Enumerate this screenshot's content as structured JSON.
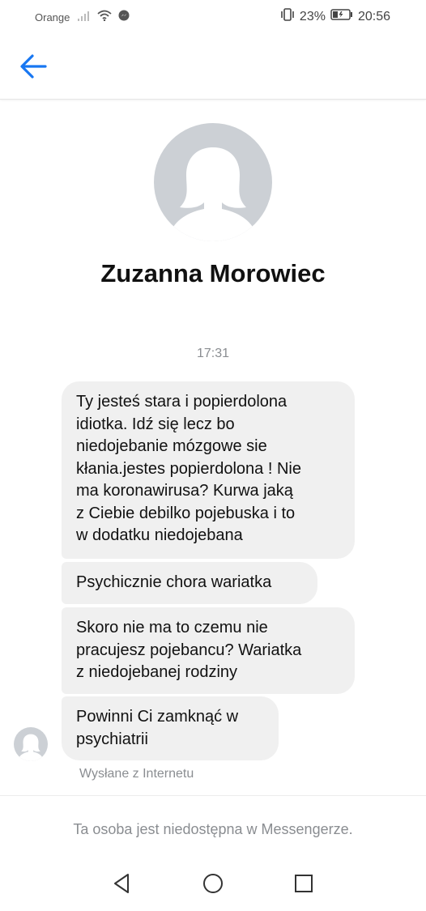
{
  "status_bar": {
    "carrier": "Orange",
    "battery_percent": "23%",
    "time": "20:56",
    "icons": [
      "signal-icon",
      "wifi-icon",
      "messenger-icon",
      "vibrate-icon",
      "battery-icon"
    ]
  },
  "header": {
    "back_icon": "arrow-left-icon",
    "accent_color": "#1877f2"
  },
  "contact": {
    "name": "Zuzanna Morowiec",
    "avatar_icon": "default-female-avatar"
  },
  "conversation": {
    "timestamp": "17:31",
    "messages": [
      {
        "text": "Ty jesteś stara i popierdolona\nidiotka.  Idź się lecz bo\nniedojebanie mózgowe sie\nkłania.jestes popierdolona ! Nie\nma koronawirusa?  Kurwa jaką\nz Ciebie debilko pojebuska i to\nw dodatku niedojebana"
      },
      {
        "text": "Psychicznie chora wariatka"
      },
      {
        "text": "Skoro nie ma to czemu nie\npracujesz pojebancu? Wariatka\nz niedojebanej rodziny"
      },
      {
        "text": "Powinni Ci zamknąć w\npsychiatrii"
      }
    ],
    "sent_from": "Wysłane z Internetu"
  },
  "footer": {
    "unavailable_notice": "Ta osoba jest niedostępna w Messengerze."
  },
  "nav_bar": {
    "icons": [
      "back-triangle-icon",
      "home-circle-icon",
      "recents-square-icon"
    ]
  }
}
